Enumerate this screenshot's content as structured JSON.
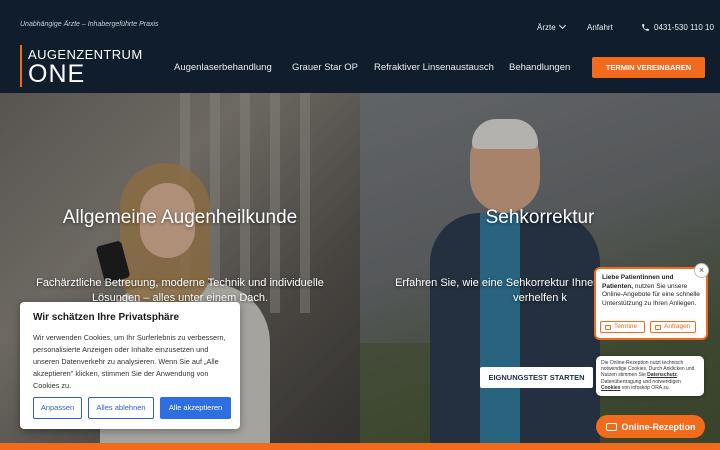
{
  "header": {
    "tagline": "Unabhängige Ärzte – Inhabergeführte Praxis",
    "logo_top": "AUGENZENTRUM",
    "logo_bottom": "ONE",
    "util": {
      "aerzte": "Ärzte",
      "anfahrt": "Anfahrt",
      "phone": "0431-530 110 10"
    },
    "nav": [
      {
        "label": "Augenlaserbehandlung"
      },
      {
        "label": "Grauer Star OP"
      },
      {
        "label": "Refraktiver Linsenaustausch"
      },
      {
        "label": "Behandlungen"
      }
    ],
    "cta": "TERMIN VEREINBAREN"
  },
  "hero": {
    "left": {
      "title": "Allgemeine Augenheilkunde",
      "desc": "Fachärztliche Betreuung, moderne Technik und individuelle Lösungen – alles unter einem Dach."
    },
    "right": {
      "title": "Sehkorrektur",
      "desc": "Erfahren Sie, wie eine Sehkorrektur Ihnen zu neuer Freiheit verhelfen k",
      "button": "EIGNUNGSTEST STARTEN"
    }
  },
  "cookie": {
    "title": "Wir schätzen Ihre Privatsphäre",
    "text": "Wir verwenden Cookies, um Ihr Surferlebnis zu verbessern, personalisierte Anzeigen oder Inhalte einzusetzen und unseren Datenverkehr zu analysieren. Wenn Sie auf „Alle akzeptieren\" klicken, stimmen Sie der Anwendung von Cookies zu.",
    "btn_customize": "Anpassen",
    "btn_reject": "Alles ablehnen",
    "btn_accept": "Alle akzeptieren"
  },
  "chat": {
    "greeting_bold": "Liebe Patientinnen und Patienten,",
    "greeting_rest": " nutzen Sie unsere Online-Angebote für eine schnelle Unterstützung zu Ihren Anliegen.",
    "btn_termine": "Termine",
    "btn_anfragen": "Anfragen",
    "close": "×",
    "privacy_pre": "Die Online-Rezeption nutzt technisch notwendige Cookies. Durch Anklicken und Nutzen stimmen Sie ",
    "privacy_link1": "Datenschutz",
    "privacy_mid": ", Datenübertragung und notwendigen ",
    "privacy_link2": "Cookies",
    "privacy_post": " von infoskop ORA zu.",
    "main_label": "Online-Rezeption"
  },
  "colors": {
    "accent": "#f26a1b",
    "header_bg": "#101d2c",
    "accept_blue": "#2f6ee0"
  }
}
